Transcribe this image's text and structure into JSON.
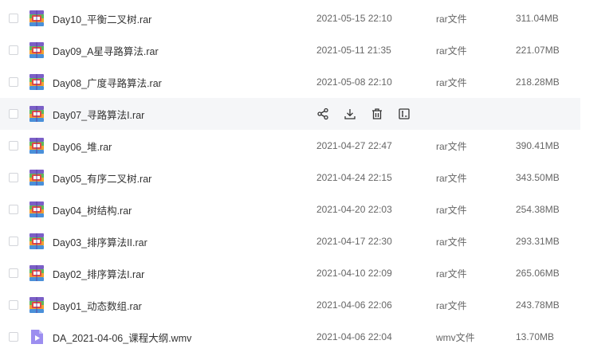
{
  "files": [
    {
      "name": "Day10_平衡二叉树.rar",
      "date": "2021-05-15 22:10",
      "type": "rar文件",
      "size": "311.04MB",
      "icon": "rar-archive-icon",
      "hovered": false
    },
    {
      "name": "Day09_A星寻路算法.rar",
      "date": "2021-05-11 21:35",
      "type": "rar文件",
      "size": "221.07MB",
      "icon": "rar-archive-icon",
      "hovered": false
    },
    {
      "name": "Day08_广度寻路算法.rar",
      "date": "2021-05-08 22:10",
      "type": "rar文件",
      "size": "218.28MB",
      "icon": "rar-archive-icon",
      "hovered": false
    },
    {
      "name": "Day07_寻路算法I.rar",
      "date": "",
      "type": "",
      "size": "",
      "icon": "rar-archive-icon",
      "hovered": true
    },
    {
      "name": "Day06_堆.rar",
      "date": "2021-04-27 22:47",
      "type": "rar文件",
      "size": "390.41MB",
      "icon": "rar-archive-icon",
      "hovered": false
    },
    {
      "name": "Day05_有序二叉树.rar",
      "date": "2021-04-24 22:15",
      "type": "rar文件",
      "size": "343.50MB",
      "icon": "rar-archive-icon",
      "hovered": false
    },
    {
      "name": "Day04_树结构.rar",
      "date": "2021-04-20 22:03",
      "type": "rar文件",
      "size": "254.38MB",
      "icon": "rar-archive-icon",
      "hovered": false
    },
    {
      "name": "Day03_排序算法II.rar",
      "date": "2021-04-17 22:30",
      "type": "rar文件",
      "size": "293.31MB",
      "icon": "rar-archive-icon",
      "hovered": false
    },
    {
      "name": "Day02_排序算法I.rar",
      "date": "2021-04-10 22:09",
      "type": "rar文件",
      "size": "265.06MB",
      "icon": "rar-archive-icon",
      "hovered": false
    },
    {
      "name": "Day01_动态数组.rar",
      "date": "2021-04-06 22:06",
      "type": "rar文件",
      "size": "243.78MB",
      "icon": "rar-archive-icon",
      "hovered": false
    },
    {
      "name": "DA_2021-04-06_课程大纲.wmv",
      "date": "2021-04-06 22:04",
      "type": "wmv文件",
      "size": "13.70MB",
      "icon": "video-file-icon",
      "hovered": false
    }
  ],
  "hover_actions": [
    {
      "name": "share-icon"
    },
    {
      "name": "download-icon"
    },
    {
      "name": "delete-icon"
    },
    {
      "name": "rename-icon"
    }
  ],
  "colors": {
    "hover_row_bg": "#f5f6f8",
    "rar_purple": "#7b5fc7",
    "rar_green": "#5cb85c",
    "rar_orange": "#f0a030",
    "rar_red": "#e04848",
    "video_purple": "#9c8ef0"
  }
}
